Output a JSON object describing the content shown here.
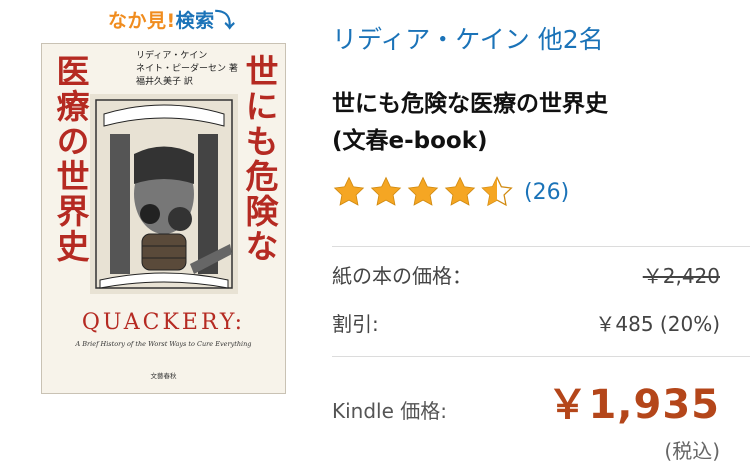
{
  "look_inside": {
    "part1": "なか見!",
    "part2": "検索",
    "arrow": "⤵"
  },
  "cover": {
    "title_left": "医療の世界史",
    "title_right": "世にも危険な",
    "authors_line1": "リディア・ケイン",
    "authors_line2": "ネイト・ピーダーセン 著",
    "translator": "福井久美子 訳",
    "english_title": "QUACKERY:",
    "english_subtitle": "A Brief History of the Worst Ways to Cure Everything",
    "publisher": "文藝春秋"
  },
  "product": {
    "author": "リディア・ケイン 他2名",
    "title_line1": "世にも危険な医療の世界史",
    "title_line2": "(文春e-book)",
    "rating": 4.5,
    "rating_count": "(26)"
  },
  "pricing": {
    "print_label": "紙の本の価格：",
    "print_price": "￥2,420",
    "discount_label": "割引:",
    "discount_value": "￥485 (20%)",
    "kindle_label": "Kindle 価格:",
    "kindle_price": "￥1,935",
    "tax_note": "(税込)"
  },
  "colors": {
    "link": "#1b73b8",
    "price": "#b4461a",
    "star": "#f5a623",
    "cover_red": "#b52a22"
  }
}
